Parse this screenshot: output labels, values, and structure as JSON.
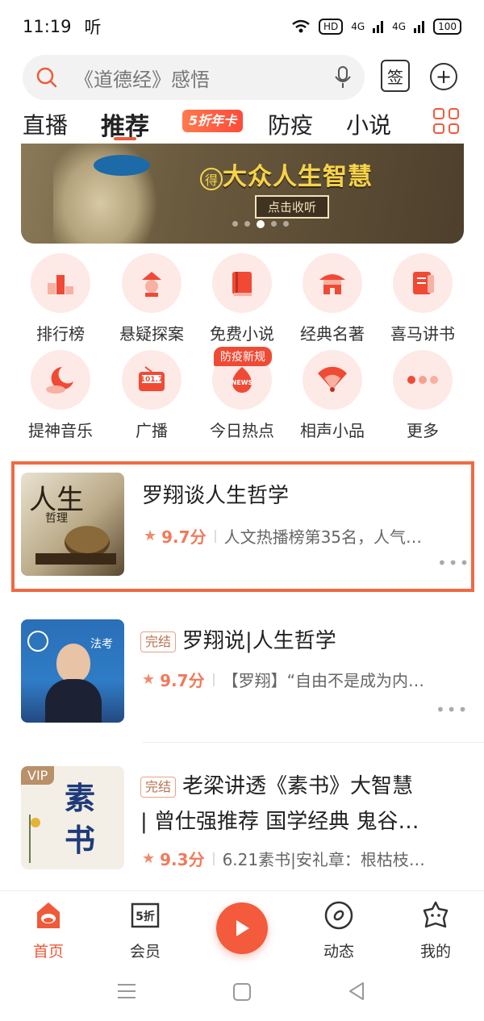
{
  "status": {
    "time": "11:19",
    "extra": "听",
    "hd": "HD",
    "sig1": "4G",
    "sig2": "4G",
    "battery": "100"
  },
  "search": {
    "placeholder": "《道德经》感悟"
  },
  "header": {
    "sign_label": "签"
  },
  "tabs": [
    {
      "label": "直播"
    },
    {
      "label": "推荐"
    },
    {
      "label": "5折年卡"
    },
    {
      "label": "防疫"
    },
    {
      "label": "小说"
    }
  ],
  "banner": {
    "prefix": "得",
    "title": "大众人生智慧",
    "cta": "点击收听"
  },
  "categories": [
    {
      "label": "排行榜",
      "icon": "ranking-icon"
    },
    {
      "label": "悬疑探案",
      "icon": "detective-icon"
    },
    {
      "label": "免费小说",
      "icon": "book-icon"
    },
    {
      "label": "经典名著",
      "icon": "temple-icon"
    },
    {
      "label": "喜马讲书",
      "icon": "notebook-icon"
    },
    {
      "label": "提神音乐",
      "icon": "moon-icon"
    },
    {
      "label": "广播",
      "icon": "radio-icon",
      "display": "101.7"
    },
    {
      "label": "今日热点",
      "icon": "news-icon",
      "tag": "防疫新规",
      "display": "NEWS"
    },
    {
      "label": "相声小品",
      "icon": "fan-icon"
    },
    {
      "label": "更多",
      "icon": "more-icon"
    }
  ],
  "feed": [
    {
      "title": "罗翔谈人生哲学",
      "score": "9.7分",
      "desc": "人文热播榜第35名，人气…",
      "cover_text": "人生",
      "cover_sub": "哲理"
    },
    {
      "tag": "完结",
      "title": "罗翔说|人生哲学",
      "score": "9.7分",
      "desc": "【罗翔】“自由不是成为内…",
      "cover_text": "法考"
    },
    {
      "tag": "完结",
      "title": "老梁讲透《素书》大智慧",
      "title2": "| 曾仕强推荐 国学经典 鬼谷…",
      "score": "9.3分",
      "desc": "6.21素书|安礼章：根枯枝…",
      "cover_text": "素书",
      "cover_badge": "VIP"
    }
  ],
  "bottom_nav": [
    {
      "label": "首页",
      "icon": "home-icon"
    },
    {
      "label": "会员",
      "icon": "vip-icon",
      "display": "5折"
    },
    {
      "label": "动态",
      "icon": "feed-icon"
    },
    {
      "label": "我的",
      "icon": "profile-icon"
    }
  ],
  "colors": {
    "accent": "#f05a3a",
    "highlight_border": "#f16a42"
  }
}
